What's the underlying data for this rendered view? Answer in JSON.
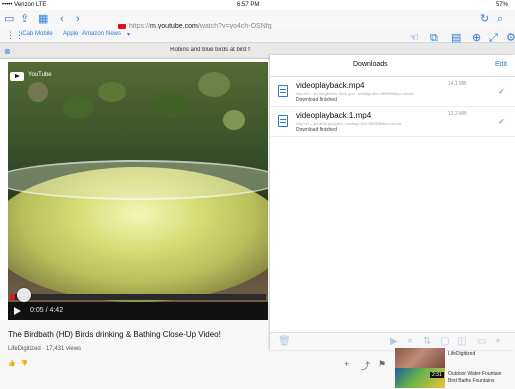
{
  "status": {
    "carrier": "••••• Verizon LTE",
    "time": "6:57 PM",
    "battery": "57%"
  },
  "browser": {
    "url_prefix": "https://",
    "url_domain": "m.youtube.com",
    "url_path": "/watch?v=yo4ch-OSNfg",
    "bookmarks": [
      "iCab Mobile",
      "Apple",
      "Amazon",
      "News"
    ],
    "tab_title": "Robins and blue birds at bird f"
  },
  "video": {
    "brand": "YouTube",
    "time": "0:05 / 4:42",
    "progress_fraction": 0.02,
    "title": "The Birdbath (HD) Birds drinking & Bathing Close-Up Video!",
    "channel": "LifeDigitized",
    "views": "· 17,431 views"
  },
  "downloads": {
    "title": "Downloads",
    "edit": "Edit",
    "items": [
      {
        "name": "videoplayback.mp4",
        "size": "14.1 MB",
        "url": "http://r2---sn-tkeg6veks-4knk.goo...mettag=&id=MWEBdiyu=mh4&",
        "status": "Download finished"
      },
      {
        "name": "videoplayback.1.mp4",
        "size": "12.2 MB",
        "url": "http://r1---sn-ab5l.googlevi...mettag=&id=MWEBdiyu=mh4&",
        "status": "Download finished"
      }
    ]
  },
  "related": [
    {
      "title": "LifeDigitized"
    },
    {
      "title": "Outdoor Water Fountain",
      "subtitle": "Bird Baths Fountains"
    }
  ],
  "related_duration": "2:31"
}
